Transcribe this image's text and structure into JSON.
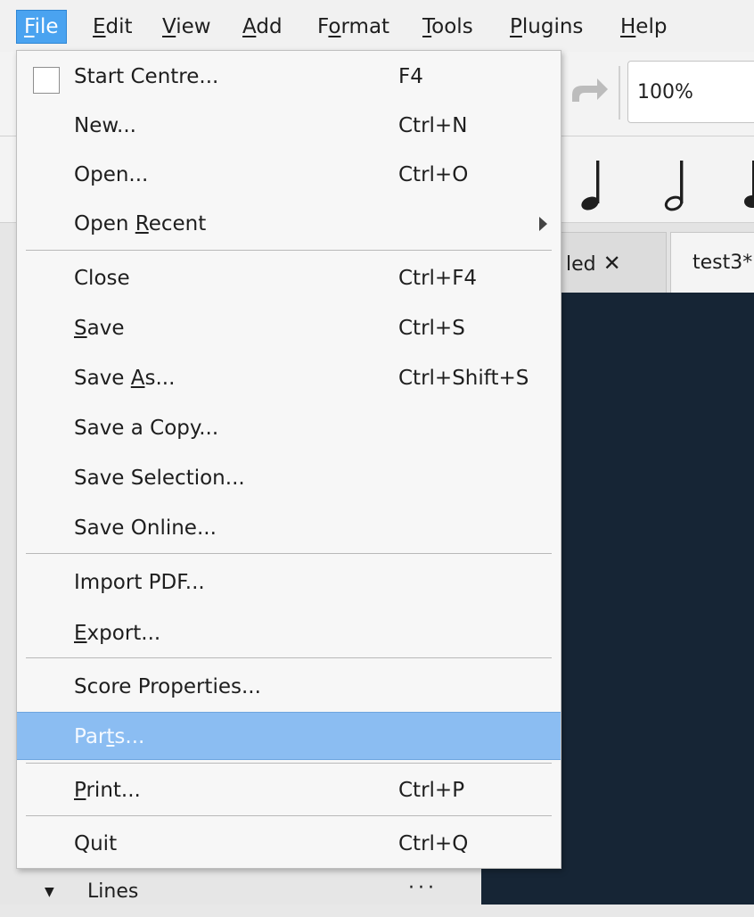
{
  "menubar": {
    "items": [
      {
        "label": "File",
        "mnemonic": "F",
        "rest": "ile",
        "active": true
      },
      {
        "label": "Edit",
        "mnemonic": "E",
        "rest": "dit"
      },
      {
        "label": "View",
        "mnemonic": "V",
        "rest": "iew"
      },
      {
        "label": "Add",
        "mnemonic": "A",
        "rest": "dd"
      },
      {
        "label": "Format",
        "pre": "F",
        "mnemonic": "o",
        "rest": "rmat"
      },
      {
        "label": "Tools",
        "mnemonic": "T",
        "rest": "ools"
      },
      {
        "label": "Plugins",
        "mnemonic": "P",
        "rest": "lugins"
      },
      {
        "label": "Help",
        "mnemonic": "H",
        "rest": "elp"
      }
    ]
  },
  "toolbar": {
    "zoom_value": "100%"
  },
  "tabs": {
    "untitled_label": "led",
    "test3_label": "test3*"
  },
  "palette": {
    "lines_label": "Lines",
    "more": "···"
  },
  "file_menu": {
    "start_centre": {
      "label": "Start Centre...",
      "shortcut": "F4"
    },
    "new": {
      "label": "New...",
      "shortcut": "Ctrl+N"
    },
    "open": {
      "label": "Open...",
      "shortcut": "Ctrl+O"
    },
    "open_recent": {
      "pre": "Open ",
      "mnemonic": "R",
      "rest": "ecent"
    },
    "close": {
      "label": "Close",
      "shortcut": "Ctrl+F4"
    },
    "save": {
      "mnemonic": "S",
      "rest": "ave",
      "shortcut": "Ctrl+S"
    },
    "save_as": {
      "pre": "Save ",
      "mnemonic": "A",
      "rest": "s...",
      "shortcut": "Ctrl+Shift+S"
    },
    "save_copy": {
      "label": "Save a Copy..."
    },
    "save_selection": {
      "label": "Save Selection..."
    },
    "save_online": {
      "label": "Save Online..."
    },
    "import_pdf": {
      "label": "Import PDF..."
    },
    "export": {
      "mnemonic": "E",
      "rest": "xport..."
    },
    "score_properties": {
      "label": "Score Properties..."
    },
    "parts": {
      "pre": "Par",
      "mnemonic": "t",
      "rest": "s..."
    },
    "print": {
      "mnemonic": "P",
      "rest": "rint...",
      "shortcut": "Ctrl+P"
    },
    "quit": {
      "label": "Quit",
      "shortcut": "Ctrl+Q"
    }
  },
  "colors": {
    "active_menu": "#4aa3f0",
    "highlight": "#8bbdf2",
    "score_background": "#162535"
  }
}
